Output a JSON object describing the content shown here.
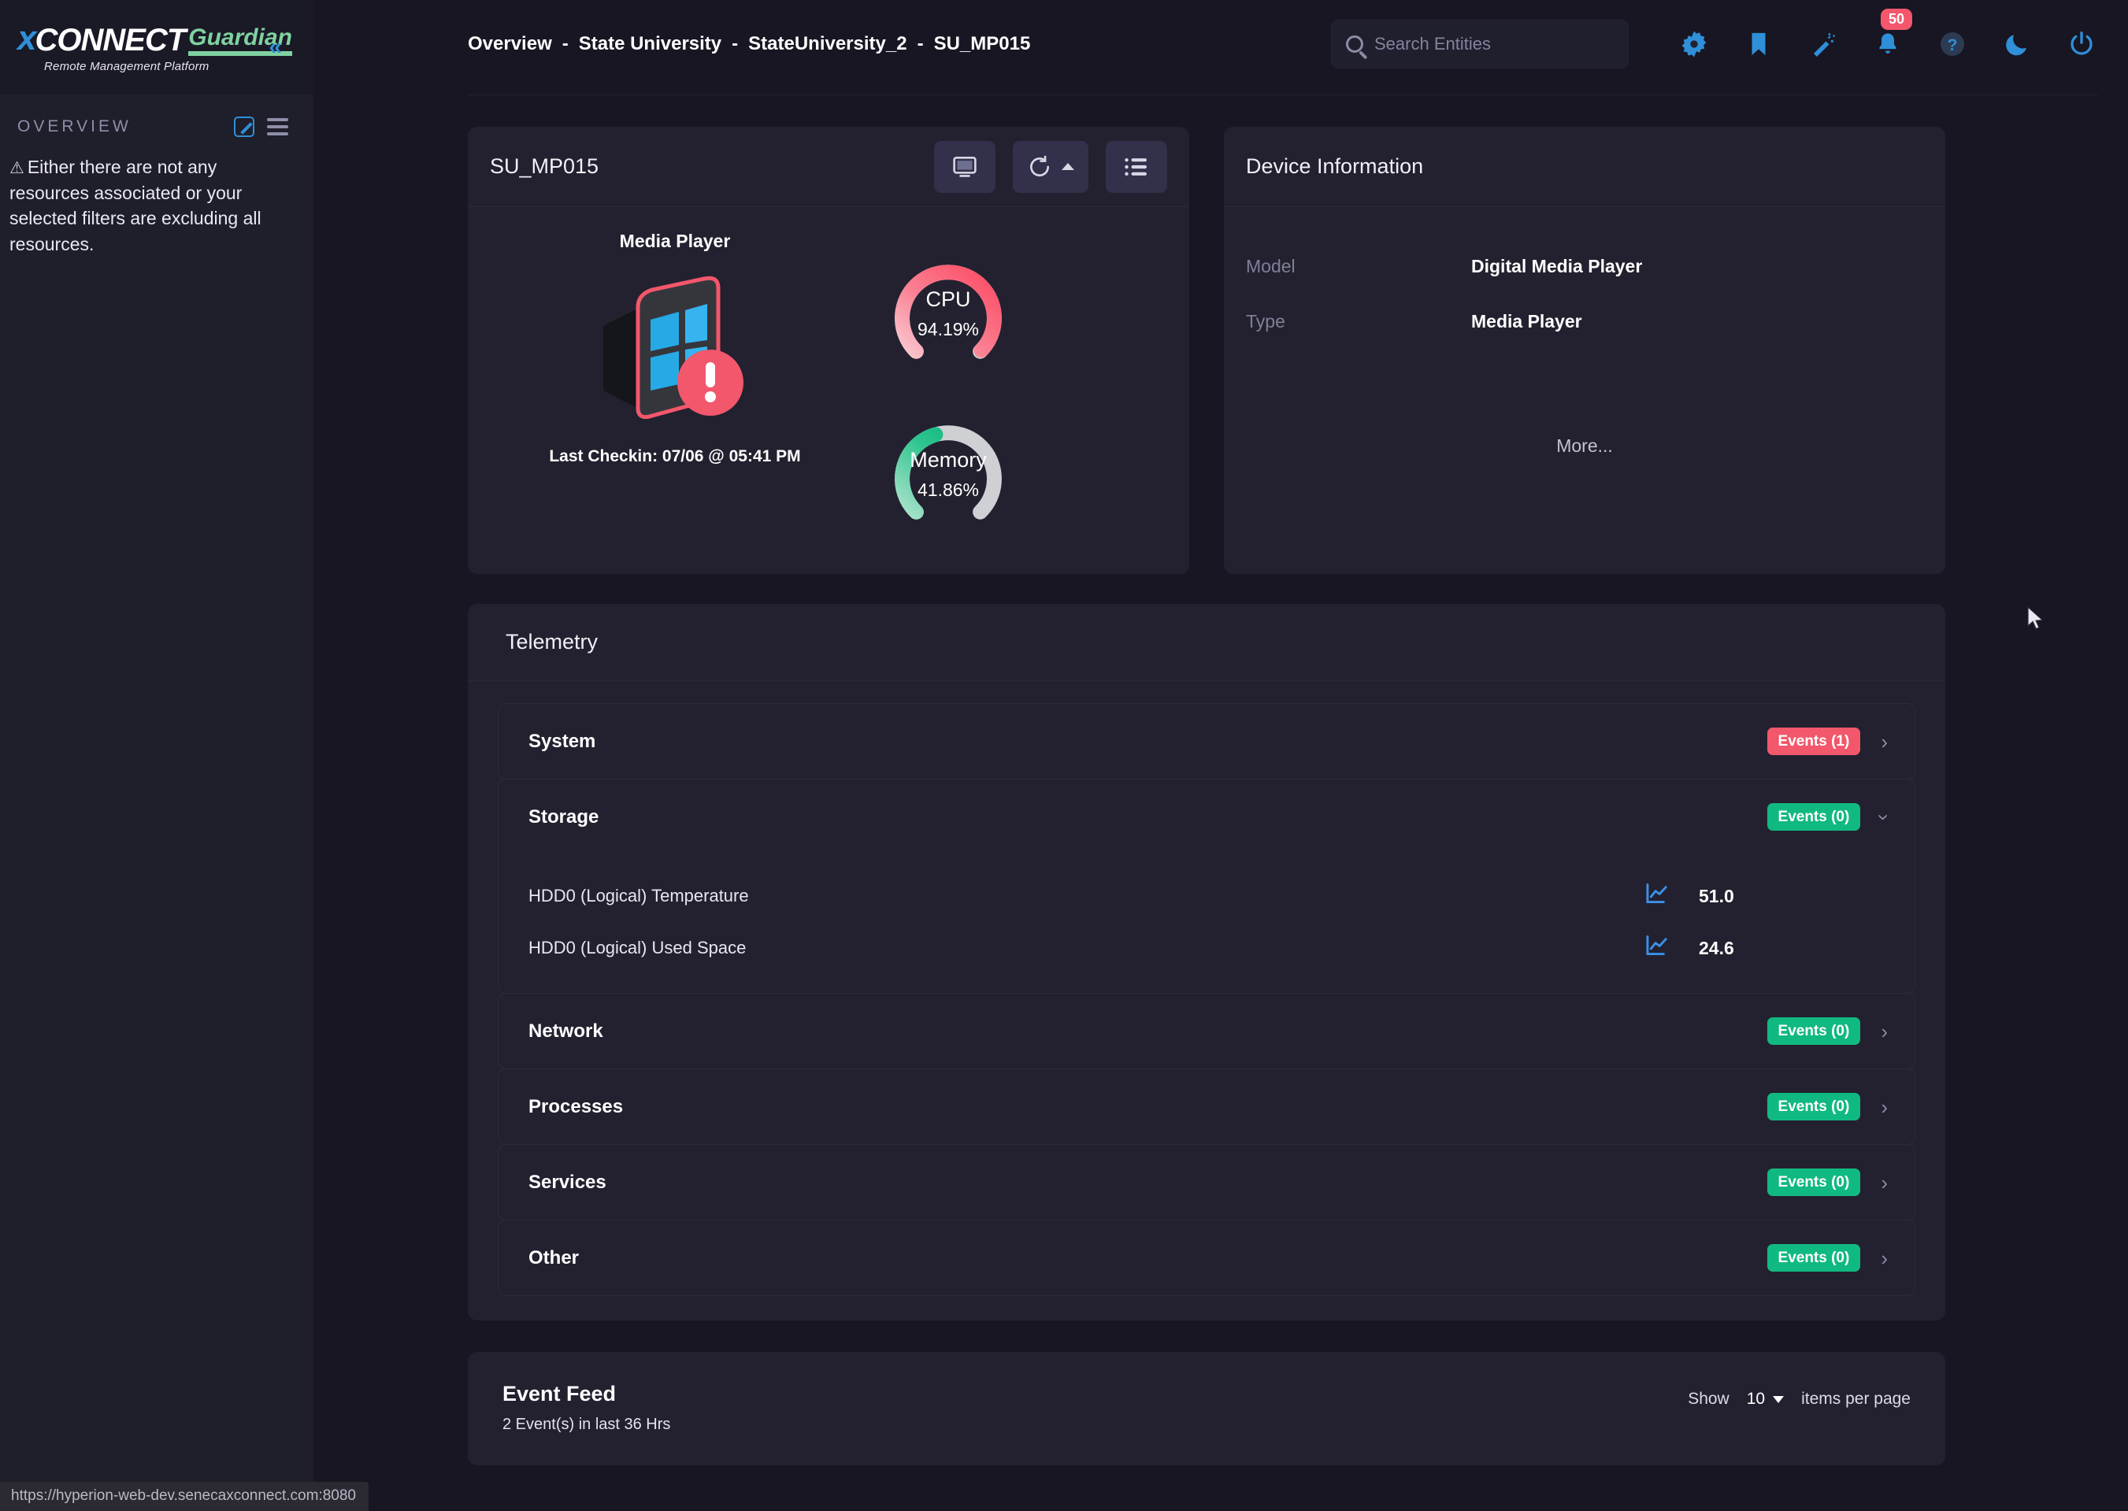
{
  "brand": {
    "x": "x",
    "connect": "CONNECT",
    "guardian": "Guardian",
    "tagline": "Remote Management Platform",
    "collapse_icon": "chevron-double-left-icon"
  },
  "sidebar": {
    "section_title": "OVERVIEW",
    "edit_icon": "edit-icon",
    "menu_icon": "hamburger-icon",
    "warning_glyph": "⚠",
    "empty_message": "Either there are not any resources associated or your selected filters are excluding all resources."
  },
  "header": {
    "breadcrumb": [
      "Overview",
      "State University",
      "StateUniversity_2",
      "SU_MP015"
    ],
    "separator": "-",
    "search": {
      "placeholder": "Search Entities",
      "value": "",
      "icon": "search-icon"
    },
    "icons": [
      {
        "name": "settings-gear-icon",
        "badge": null
      },
      {
        "name": "bookmark-icon",
        "badge": null
      },
      {
        "name": "magic-wand-icon",
        "badge": null
      },
      {
        "name": "notification-bell-icon",
        "badge": "50"
      },
      {
        "name": "help-circle-icon",
        "badge": null
      },
      {
        "name": "dark-mode-moon-icon",
        "badge": null
      },
      {
        "name": "power-icon",
        "badge": null
      }
    ]
  },
  "device_card": {
    "title": "SU_MP015",
    "buttons": [
      {
        "name": "remote-screen-button",
        "icon": "monitor-icon"
      },
      {
        "name": "reboot-button",
        "icon": "refresh-icon",
        "caret": "caret-up-icon"
      },
      {
        "name": "actions-list-button",
        "icon": "list-icon"
      }
    ],
    "device_type": "Media Player",
    "last_checkin": "Last Checkin: 07/06 @ 05:41 PM",
    "status": "alert",
    "gauges": [
      {
        "label": "CPU",
        "value": "94.19%",
        "percent": 94.19,
        "color": "#fb4b63"
      },
      {
        "label": "Memory",
        "value": "41.86%",
        "percent": 41.86,
        "color": "#00b178"
      }
    ]
  },
  "device_information": {
    "title": "Device Information",
    "rows": [
      {
        "key": "Model",
        "value": "Digital Media Player"
      },
      {
        "key": "Type",
        "value": "Media Player"
      }
    ],
    "more_label": "More..."
  },
  "telemetry": {
    "title": "Telemetry",
    "groups": [
      {
        "name": "System",
        "events_label": "Events (1)",
        "events_count": 1,
        "badge_color": "#f2576b",
        "expanded": false,
        "chevron": "chevron-right-icon",
        "metrics": []
      },
      {
        "name": "Storage",
        "events_label": "Events (0)",
        "events_count": 0,
        "badge_color": "#10b981",
        "expanded": true,
        "chevron": "chevron-down-icon",
        "metrics": [
          {
            "name": "HDD0 (Logical) Temperature",
            "value": "51.0",
            "chart_icon": "line-chart-icon"
          },
          {
            "name": "HDD0 (Logical) Used Space",
            "value": "24.6",
            "chart_icon": "line-chart-icon"
          }
        ]
      },
      {
        "name": "Network",
        "events_label": "Events (0)",
        "events_count": 0,
        "badge_color": "#10b981",
        "expanded": false,
        "chevron": "chevron-right-icon",
        "metrics": []
      },
      {
        "name": "Processes",
        "events_label": "Events (0)",
        "events_count": 0,
        "badge_color": "#10b981",
        "expanded": false,
        "chevron": "chevron-right-icon",
        "metrics": []
      },
      {
        "name": "Services",
        "events_label": "Events (0)",
        "events_count": 0,
        "badge_color": "#10b981",
        "expanded": false,
        "chevron": "chevron-right-icon",
        "metrics": []
      },
      {
        "name": "Other",
        "events_label": "Events (0)",
        "events_count": 0,
        "badge_color": "#10b981",
        "expanded": false,
        "chevron": "chevron-right-icon",
        "metrics": []
      }
    ]
  },
  "event_feed": {
    "title": "Event Feed",
    "subtitle": "2 Event(s) in last 36 Hrs",
    "show_label": "Show",
    "page_size": "10",
    "items_label": "items per page"
  },
  "status_bar": {
    "url": "https://hyperion-web-dev.senecaxconnect.com:8080"
  },
  "colors": {
    "page_bg": "#171622",
    "sidebar_bg": "#1f1e2b",
    "card_bg": "#23212f",
    "accent_blue": "#2f8fd8",
    "danger": "#f2576b",
    "success": "#10b981",
    "guardian_green": "#7fd2a0"
  }
}
